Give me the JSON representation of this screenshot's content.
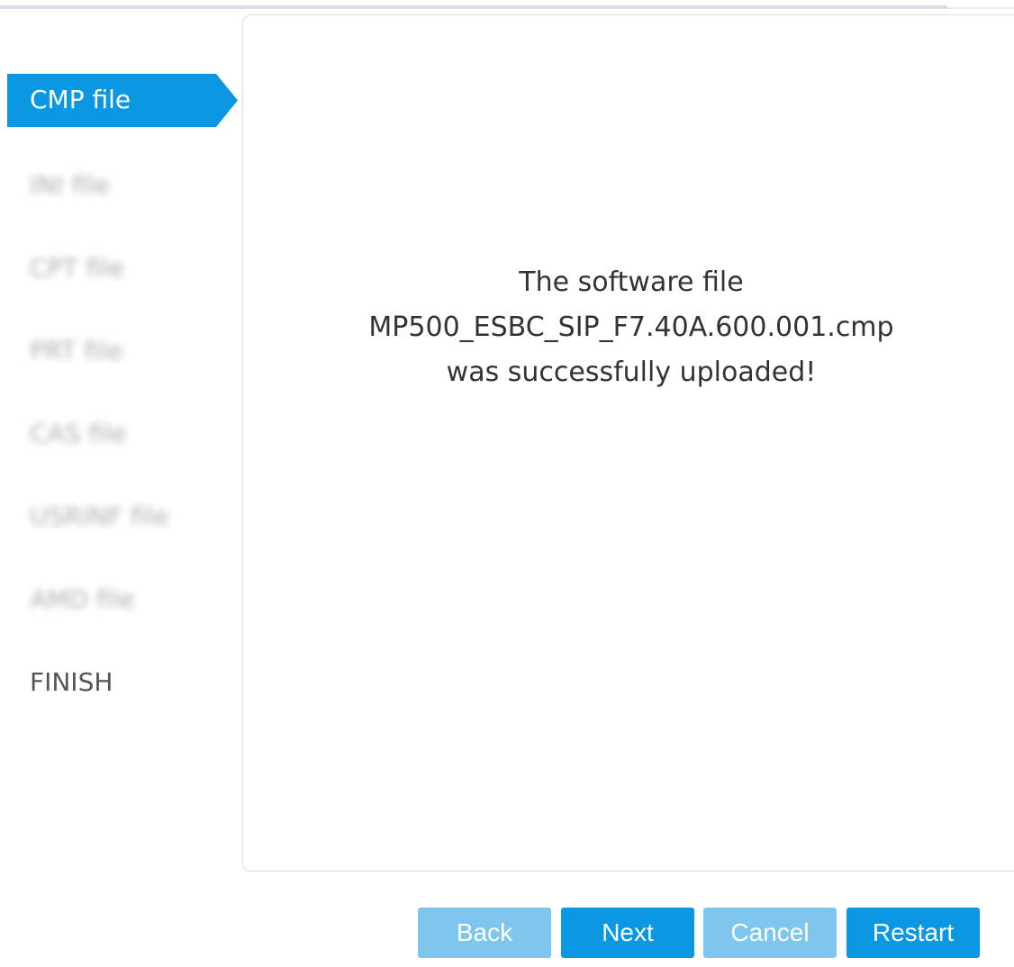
{
  "wizard": {
    "steps": [
      {
        "label": "CMP file",
        "state": "active"
      },
      {
        "label": "INI file",
        "state": "blurred"
      },
      {
        "label": "CPT file",
        "state": "blurred"
      },
      {
        "label": "PRT file",
        "state": "blurred"
      },
      {
        "label": "CAS file",
        "state": "blurred"
      },
      {
        "label": "USRINF file",
        "state": "blurred"
      },
      {
        "label": "AMD file",
        "state": "blurred"
      },
      {
        "label": "FINISH",
        "state": "inactive"
      }
    ]
  },
  "content": {
    "message_lines": [
      "The software file",
      "MP500_ESBC_SIP_F7.40A.600.001.cmp",
      "was successfully uploaded!"
    ]
  },
  "buttons": {
    "back": {
      "label": "Back",
      "enabled": false
    },
    "next": {
      "label": "Next",
      "enabled": true
    },
    "cancel": {
      "label": "Cancel",
      "enabled": false
    },
    "restart": {
      "label": "Restart",
      "enabled": true
    }
  },
  "colors": {
    "accent": "#0b97e1",
    "disabled_button": "#7fc6ee",
    "panel_border": "#d8dde2"
  }
}
